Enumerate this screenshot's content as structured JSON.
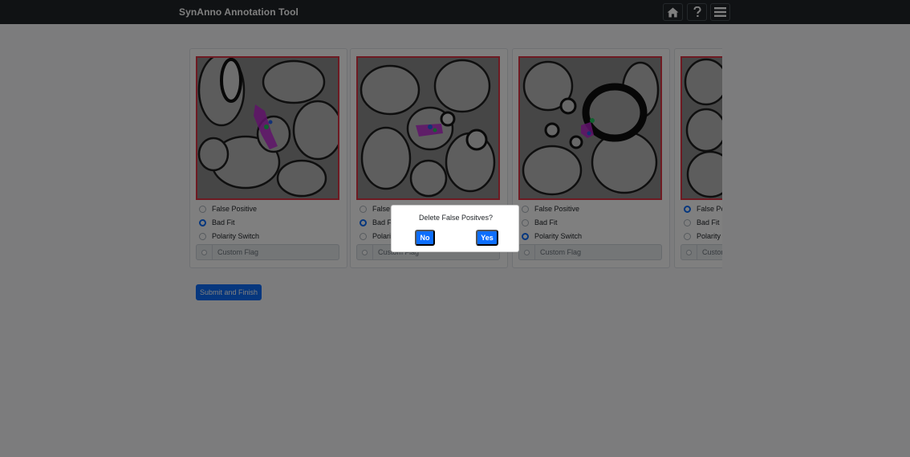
{
  "navbar": {
    "brand": "SynAnno Annotation Tool",
    "icons": [
      "home-icon",
      "question-icon",
      "menu-icon"
    ]
  },
  "cards": [
    {
      "options": [
        "False Positive",
        "Bad Fit",
        "Polarity Switch"
      ],
      "selected": "Bad Fit",
      "custom_flag": "Custom Flag"
    },
    {
      "options": [
        "False Positive",
        "Bad Fit",
        "Polarity Switch"
      ],
      "selected": "Bad Fit",
      "custom_flag": "Custom Flag"
    },
    {
      "options": [
        "False Positive",
        "Bad Fit",
        "Polarity Switch"
      ],
      "selected": "Polarity Switch",
      "custom_flag": "Custom Flag"
    },
    {
      "options": [
        "False Positive",
        "Bad Fit",
        "Polarity Switch"
      ],
      "selected": "False Positive",
      "custom_flag": "Custom Flag"
    }
  ],
  "submit_label": "Submit and Finish",
  "modal": {
    "question": "Delete False Positves?",
    "no_label": "No",
    "yes_label": "Yes"
  },
  "colors": {
    "navbar": "#212529",
    "accent": "#0d6efd",
    "image_border": "#dc3545",
    "annotation_magenta": "#c026d3",
    "annotation_green": "#22c55e"
  }
}
